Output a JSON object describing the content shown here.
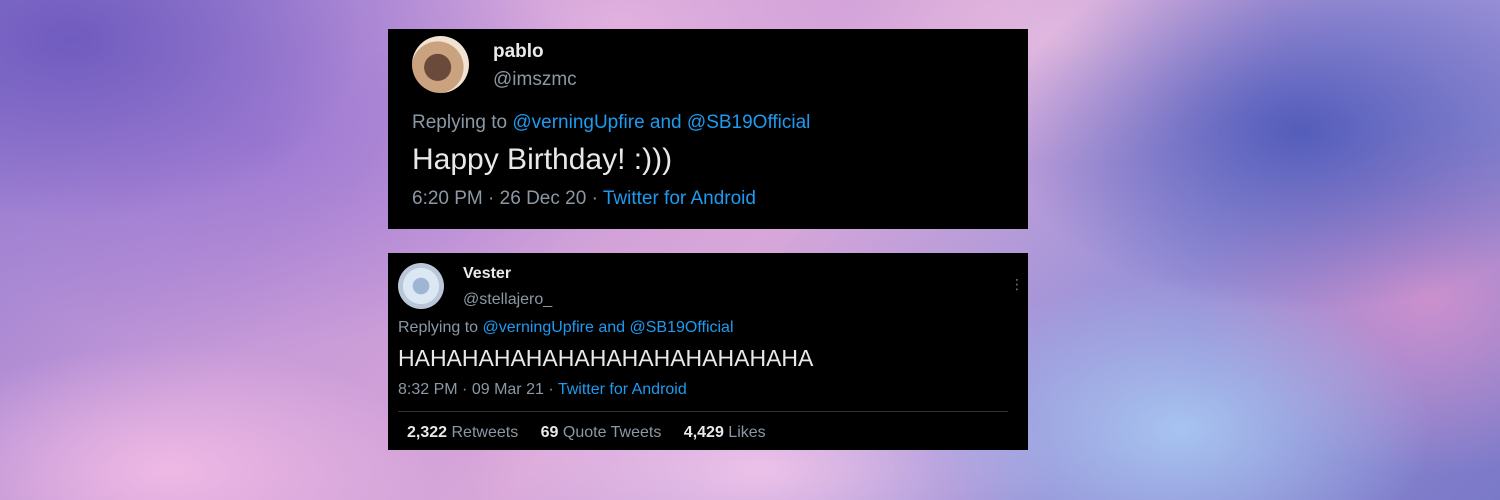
{
  "tweets": [
    {
      "display_name": "pablo",
      "handle": "@imszmc",
      "replying_prefix": "Replying to",
      "mention_1": "@verningUpfire",
      "mention_joiner": "and",
      "mention_2": "@SB19Official",
      "text": "Happy Birthday! :)))",
      "time": "6:20 PM",
      "date": "26 Dec 20",
      "separator": "·",
      "source": "Twitter for Android"
    },
    {
      "display_name": "Vester",
      "handle": "@stellajero_",
      "replying_prefix": "Replying to",
      "mention_1": "@verningUpfire",
      "mention_joiner": "and",
      "mention_2": "@SB19Official",
      "text": "HAHAHAHAHAHAHAHAHAHAHAHAHA",
      "time": "8:32 PM",
      "date": "09 Mar 21",
      "separator": "·",
      "source": "Twitter for Android",
      "more_icon": "⋮",
      "stats": {
        "retweets_count": "2,322",
        "retweets_label": "Retweets",
        "quotes_count": "69",
        "quotes_label": "Quote Tweets",
        "likes_count": "4,429",
        "likes_label": "Likes"
      }
    }
  ],
  "colors": {
    "card_background": "#000000",
    "primary_text": "#e7e9ea",
    "secondary_text": "#8b98a5",
    "link": "#1d9bf0"
  }
}
